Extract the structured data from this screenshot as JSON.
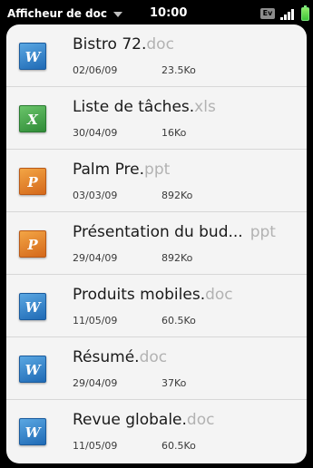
{
  "status_bar": {
    "app_title": "Afficheur de doc",
    "time": "10:00",
    "ev_label": "Ev",
    "icons": [
      "chevron-down-icon",
      "ev-icon",
      "signal-icon",
      "battery-icon"
    ]
  },
  "colors": {
    "doc": "#2b7fcd",
    "xls": "#3da047",
    "ppt": "#e7832c",
    "extension_text": "#b2b2b2",
    "panel_background": "#f4f4f4"
  },
  "documents": [
    {
      "name": "Bistro 72.",
      "ext": "doc",
      "icon_letter": "W",
      "icon": "word-doc-icon",
      "date": "02/06/09",
      "size": "23.5Ko"
    },
    {
      "name": "Liste de tâches.",
      "ext": "xls",
      "icon_letter": "X",
      "icon": "excel-sheet-icon",
      "date": "30/04/09",
      "size": "16Ko"
    },
    {
      "name": "Palm Pre.",
      "ext": "ppt",
      "icon_letter": "P",
      "icon": "powerpoint-icon",
      "date": "03/03/09",
      "size": "892Ko"
    },
    {
      "name": "Présentation du bud...",
      "ext": "ppt",
      "icon_letter": "P",
      "icon": "powerpoint-icon",
      "date": "29/04/09",
      "size": "892Ko"
    },
    {
      "name": "Produits mobiles.",
      "ext": "doc",
      "icon_letter": "W",
      "icon": "word-doc-icon",
      "date": "11/05/09",
      "size": "60.5Ko"
    },
    {
      "name": "Résumé.",
      "ext": "doc",
      "icon_letter": "W",
      "icon": "word-doc-icon",
      "date": "29/04/09",
      "size": "37Ko"
    },
    {
      "name": "Revue globale.",
      "ext": "doc",
      "icon_letter": "W",
      "icon": "word-doc-icon",
      "date": "11/05/09",
      "size": "60.5Ko"
    }
  ]
}
